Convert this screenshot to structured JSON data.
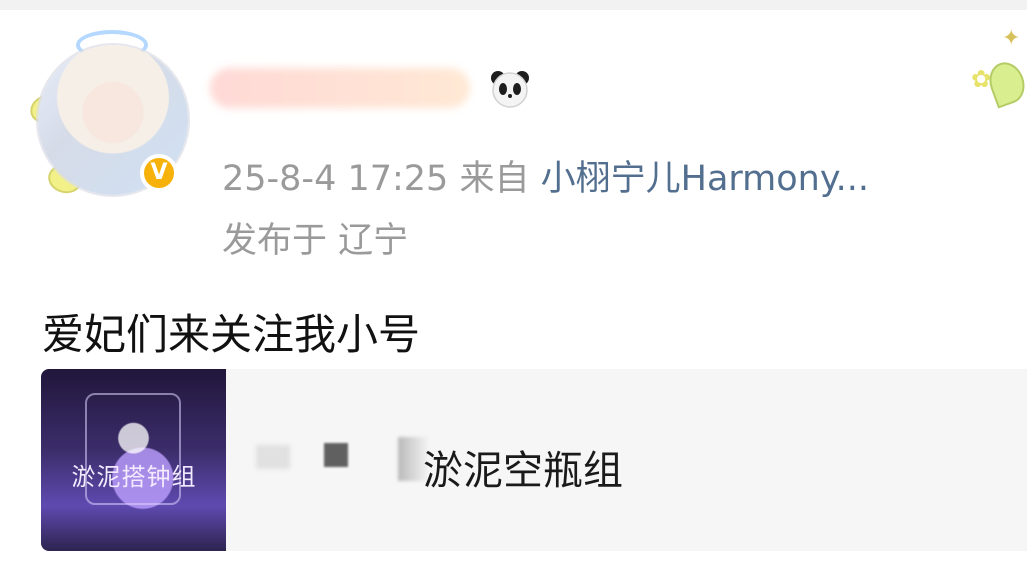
{
  "post": {
    "avatar_badge": "V",
    "meta": {
      "time": "25-8-4 17:25",
      "source_prefix": "来自",
      "source_link": "小栩宁儿Harmony...",
      "location": "发布于 辽宁"
    },
    "content": "爱妃们来关注我小号",
    "card": {
      "thumbnail_caption": "淤泥搭钟组",
      "title": "淤泥空瓶组"
    }
  },
  "icons": {
    "avatar": "profile-avatar-icon",
    "verified": "verified-badge-icon",
    "panda": "panda-icon",
    "decoration": "sticker-decoration-icon"
  },
  "colors": {
    "link": "#536f8f",
    "meta": "#9a9a9a",
    "card_bg": "#f6f6f6",
    "verified": "#f6b20a"
  }
}
